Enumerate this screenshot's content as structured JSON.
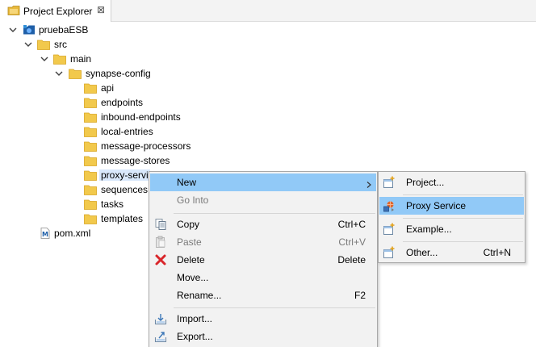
{
  "view": {
    "title": "Project Explorer",
    "close_symbol": "⊠",
    "icon": "project-explorer-icon"
  },
  "tree": {
    "project": "pruebaESB",
    "src": "src",
    "main": "main",
    "synapse_config": "synapse-config",
    "children": [
      "api",
      "endpoints",
      "inbound-endpoints",
      "local-entries",
      "message-processors",
      "message-stores",
      "proxy-servi",
      "sequences",
      "tasks",
      "templates"
    ],
    "pom": "pom.xml"
  },
  "context_menu": {
    "new": "New",
    "go_into": "Go Into",
    "copy": "Copy",
    "copy_shortcut": "Ctrl+C",
    "paste": "Paste",
    "paste_shortcut": "Ctrl+V",
    "delete": "Delete",
    "delete_shortcut": "Delete",
    "move": "Move...",
    "rename": "Rename...",
    "rename_shortcut": "F2",
    "import": "Import...",
    "export": "Export..."
  },
  "submenu": {
    "project": "Project...",
    "proxy_service": "Proxy Service",
    "example": "Example...",
    "other": "Other...",
    "other_shortcut": "Ctrl+N"
  },
  "colors": {
    "folder": "#f2c94c",
    "highlight": "#91c9f7",
    "selection": "#d9e8fb",
    "menu_bg": "#f2f2f2"
  }
}
